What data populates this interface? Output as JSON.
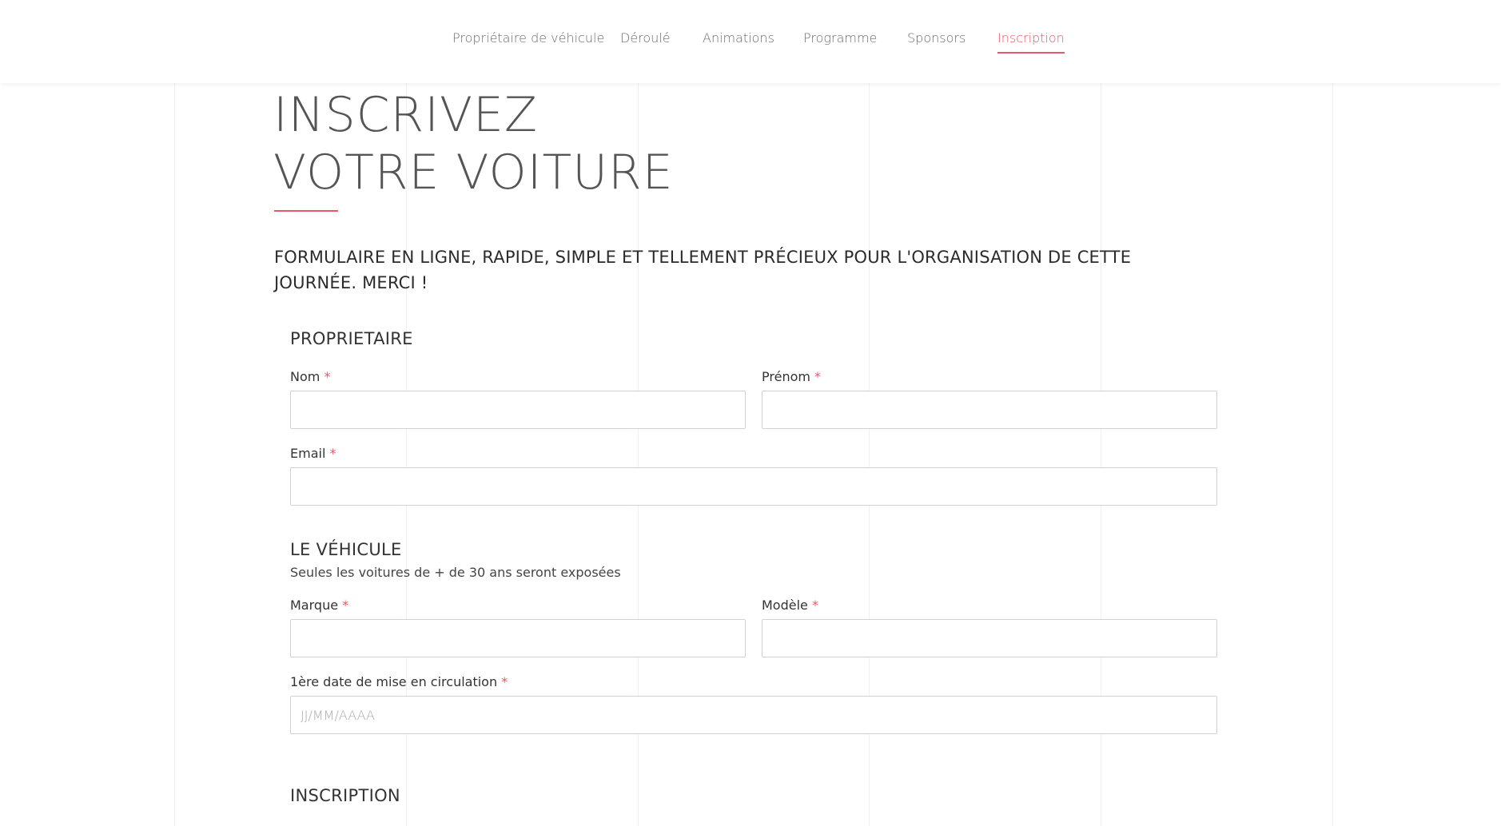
{
  "nav": {
    "items": [
      {
        "label": "Propriétaire de véhicule"
      },
      {
        "label": "Déroulé"
      },
      {
        "label": "Animations"
      },
      {
        "label": "Programme"
      },
      {
        "label": "Sponsors"
      },
      {
        "label": "Inscription"
      }
    ],
    "active": "Inscription"
  },
  "page": {
    "title_line1": "INSCRIVEZ",
    "title_line2": "VOTRE VOITURE",
    "intro": "FORMULAIRE EN LIGNE, RAPIDE, SIMPLE ET TELLEMENT PRÉCIEUX POUR L'ORGANISATION DE CETTE JOURNÉE. MERCI !"
  },
  "form": {
    "owner": {
      "title": "PROPRIETAIRE",
      "nom_label": "Nom",
      "prenom_label": "Prénom",
      "email_label": "Email",
      "nom_value": "",
      "prenom_value": "",
      "email_value": ""
    },
    "vehicle": {
      "title": "LE VÉHICULE",
      "subtitle": "Seules les voitures de + de 30 ans seront exposées",
      "marque_label": "Marque",
      "modele_label": "Modèle",
      "date_label": "1ère date de mise en circulation",
      "date_placeholder": "JJ/MM/AAAA",
      "marque_value": "",
      "modele_value": "",
      "date_value": ""
    },
    "inscription": {
      "title": "INSCRIPTION"
    },
    "required_mark": "*"
  },
  "colors": {
    "accent": "#e8576a",
    "text": "#333333",
    "border": "#cfd3d7",
    "guide": "#eef0f2"
  }
}
